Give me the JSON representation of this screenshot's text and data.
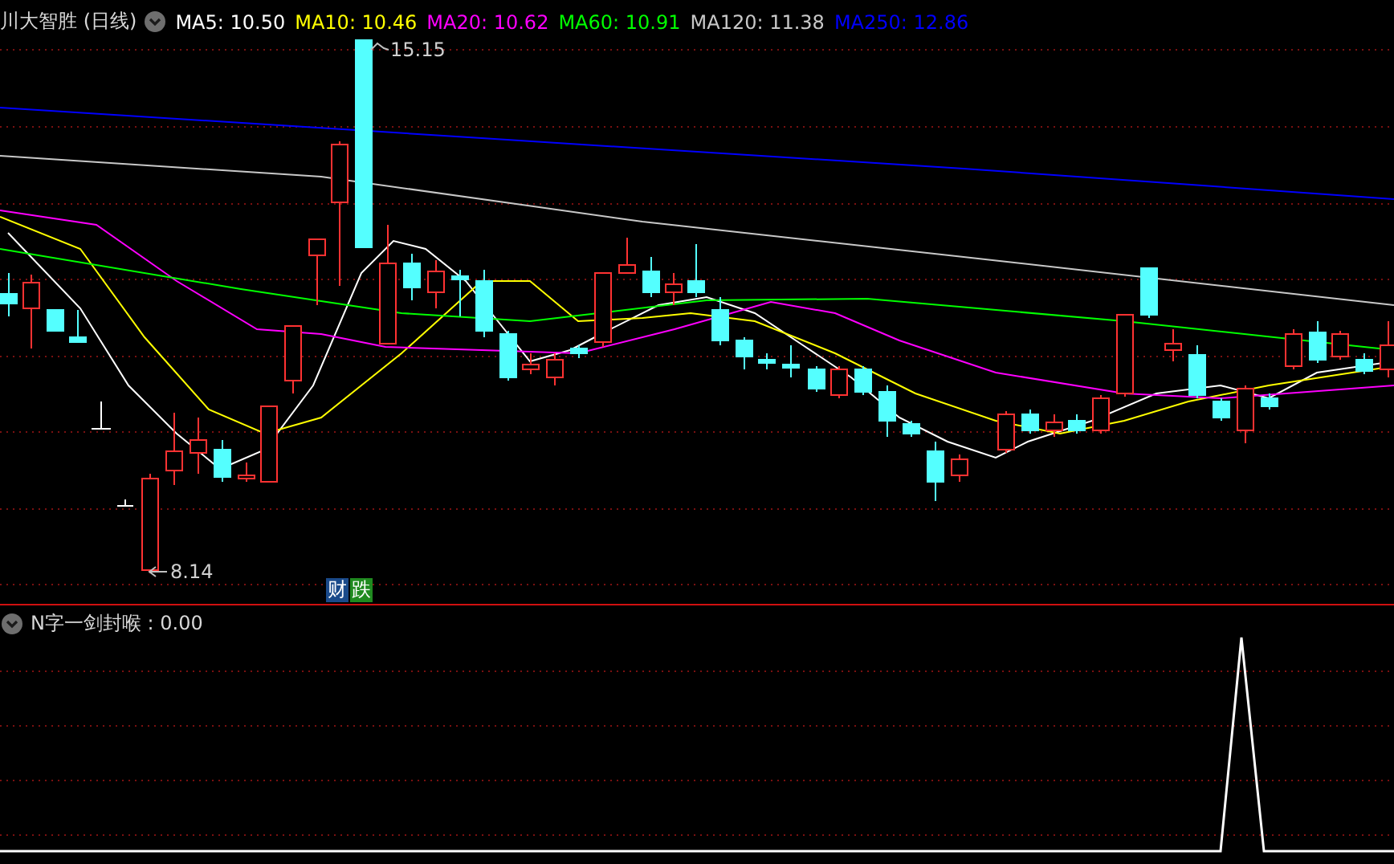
{
  "chart_header": {
    "title": "川大智胜 (日线)",
    "moving_averages": [
      {
        "text": "MA5: 10.50",
        "color": "#ffffff"
      },
      {
        "text": "MA10: 10.46",
        "color": "#ffff00"
      },
      {
        "text": "MA20: 10.62",
        "color": "#ff00ff"
      },
      {
        "text": "MA60: 10.91",
        "color": "#00ff00"
      },
      {
        "text": "MA120: 11.38",
        "color": "#c8c8c8"
      },
      {
        "text": "MA250: 12.86",
        "color": "#0000ff"
      }
    ]
  },
  "price_chart": {
    "high_label": "15.15",
    "low_label": "8.14",
    "badges": [
      {
        "text": "财",
        "color": "#1a4a8a"
      },
      {
        "text": "跌",
        "color": "#1f8a1f"
      }
    ]
  },
  "indicator_panel": {
    "label": "N字一剑封喉 : 0.00"
  }
}
